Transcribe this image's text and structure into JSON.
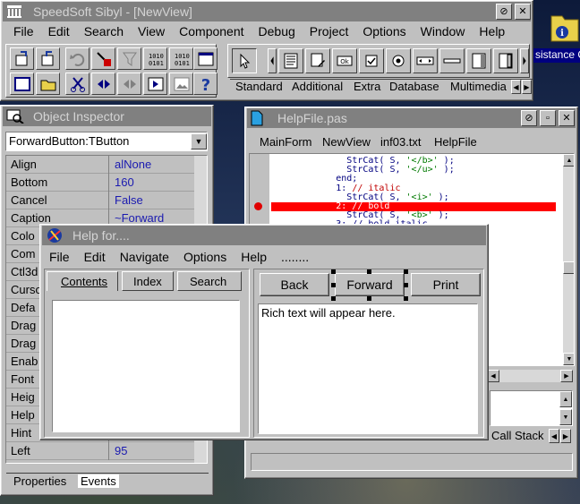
{
  "ide": {
    "title": "SpeedSoft Sibyl - [NewView]",
    "menu": [
      "File",
      "Edit",
      "Search",
      "View",
      "Component",
      "Debug",
      "Project",
      "Options",
      "Window",
      "Help"
    ],
    "palette_tabs": [
      "Standard",
      "Additional",
      "Extra",
      "Database",
      "Multimedia"
    ]
  },
  "inspector": {
    "title": "Object Inspector",
    "selected": "ForwardButton:TButton",
    "properties": [
      {
        "name": "Align",
        "value": "alNone"
      },
      {
        "name": "Bottom",
        "value": "160"
      },
      {
        "name": "Cancel",
        "value": "False"
      },
      {
        "name": "Caption",
        "value": "~Forward"
      },
      {
        "name": "Colo",
        "value": ""
      },
      {
        "name": "Com",
        "value": ""
      },
      {
        "name": "Ctl3d",
        "value": ""
      },
      {
        "name": "Curso",
        "value": ""
      },
      {
        "name": "Defa",
        "value": ""
      },
      {
        "name": "Drag",
        "value": ""
      },
      {
        "name": "Drag",
        "value": ""
      },
      {
        "name": "Enab",
        "value": ""
      },
      {
        "name": "Font",
        "value": ""
      },
      {
        "name": "Heig",
        "value": ""
      },
      {
        "name": "Help",
        "value": ""
      },
      {
        "name": "Hint",
        "value": ""
      },
      {
        "name": "Left",
        "value": "95"
      }
    ],
    "tabs": [
      "Properties",
      "Events"
    ]
  },
  "editor": {
    "title": "HelpFile.pas",
    "tabs": [
      "MainForm",
      "NewView",
      "inf03.txt",
      "HelpFile"
    ],
    "lines": [
      {
        "indent": "              ",
        "text": "StrCat( S, ",
        "str": "'</b>'",
        "tail": " );"
      },
      {
        "indent": "              ",
        "text": "StrCat( S, ",
        "str": "'</u>'",
        "tail": " );"
      },
      {
        "indent": "            ",
        "text": "end;",
        "str": "",
        "tail": ""
      },
      {
        "indent": "            ",
        "text": "1: ",
        "str": "// italic",
        "tail": ""
      },
      {
        "indent": "              ",
        "text": "StrCat( S, ",
        "str": "'<i>'",
        "tail": " );"
      },
      {
        "indent": "            ",
        "text": "2: // bold",
        "str": "",
        "tail": ""
      },
      {
        "indent": "              ",
        "text": "StrCat( S, ",
        "str": "'<b>'",
        "tail": " );"
      },
      {
        "indent": "            ",
        "text": "3: // bold italic",
        "str": "",
        "tail": ""
      }
    ],
    "bottom_tab": "Call Stack"
  },
  "helpform": {
    "title": "Help for....",
    "menu": [
      "File",
      "Edit",
      "Navigate",
      "Options",
      "Help",
      "........"
    ],
    "tabs": [
      "Contents",
      "Index",
      "Search"
    ],
    "buttons": [
      "Back",
      "Forward",
      "Print"
    ],
    "richtext": "Rich text will appear here."
  },
  "desktop": {
    "icon_label": "sistance C"
  }
}
